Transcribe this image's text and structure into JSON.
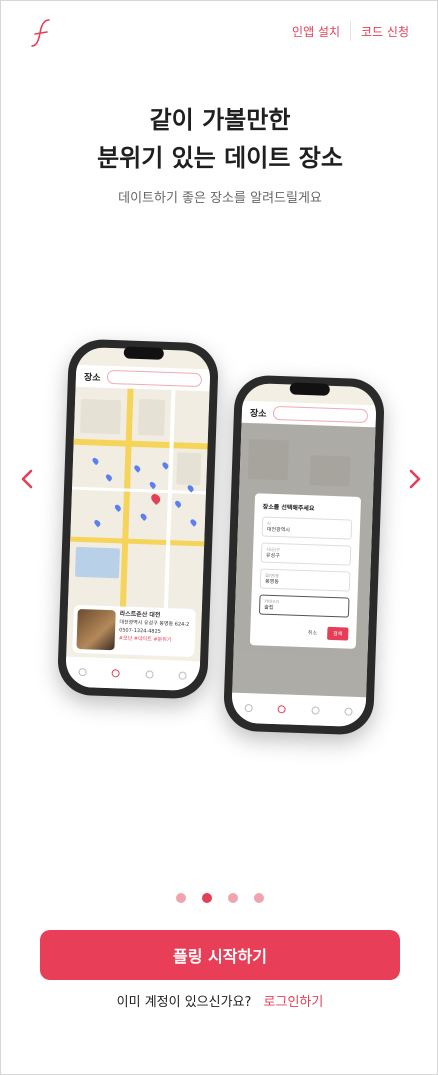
{
  "header": {
    "logo_icon": "cursive-f-logo",
    "install_label": "인앱 설치",
    "code_label": "코드 신청"
  },
  "hero": {
    "title_line1": "같이 가볼만한",
    "title_line2": "분위기 있는 데이트 장소",
    "subtitle": "데이트하기 좋은 장소를 알려드릴게요"
  },
  "carousel": {
    "current_index": 2,
    "total": 4,
    "prev_icon": "chevron-left-icon",
    "next_icon": "chevron-right-icon"
  },
  "phone_left": {
    "screen_title": "장소",
    "card_title": "라스트춘산 대전",
    "card_address": "대전광역시 유성구 봉명동 624-2",
    "card_phone": "0507-1324-4825",
    "card_tag": "#모던 #데이트 #분위기"
  },
  "phone_right": {
    "screen_title": "장소",
    "modal_title": "장소를 선택해주세요",
    "fields": [
      {
        "label": "시",
        "value": "대전광역시"
      },
      {
        "label": "시/군/구",
        "value": "유성구"
      },
      {
        "label": "읍/면/동",
        "value": "봉명동"
      },
      {
        "label": "카테고리",
        "value": "술집"
      }
    ],
    "cancel_label": "취소",
    "confirm_label": "검색"
  },
  "cta": {
    "start_label": "플링 시작하기",
    "have_account": "이미 계정이 있으신가요?",
    "login_label": "로그인하기"
  },
  "colors": {
    "accent": "#e83e57",
    "dot_inactive": "#f2a3ae"
  }
}
